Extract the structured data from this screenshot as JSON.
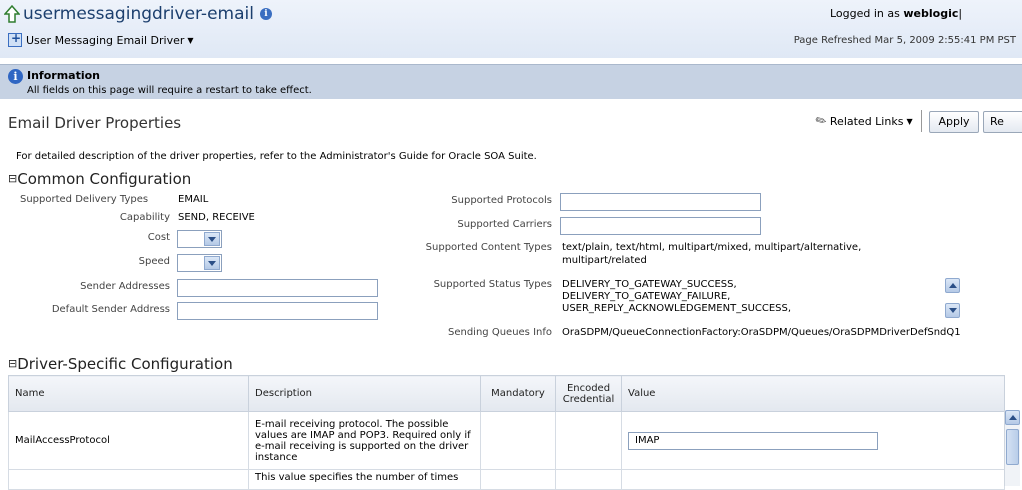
{
  "header": {
    "app_title": "usermessagingdriver-email",
    "target_menu": "User Messaging Email Driver",
    "logged_in_prefix": "Logged in as",
    "user": "weblogic",
    "refreshed": "Page Refreshed Mar 5, 2009 2:55:41 PM PST"
  },
  "info": {
    "title": "Information",
    "text": "All fields on this page will require a restart to take effect."
  },
  "page": {
    "title": "Email Driver Properties",
    "related_links": "Related Links",
    "apply": "Apply",
    "revert": "Re",
    "description": "For detailed description of the driver properties, refer to the Administrator's Guide for Oracle SOA Suite."
  },
  "common": {
    "section_title": "Common Configuration",
    "toggle": "⊟",
    "delivery_types_label": "Supported Delivery Types",
    "delivery_types_value": "EMAIL",
    "capability_label": "Capability",
    "capability_value": "SEND, RECEIVE",
    "cost_label": "Cost",
    "speed_label": "Speed",
    "sender_addresses_label": "Sender Addresses",
    "default_sender_label": "Default Sender Address",
    "protocols_label": "Supported Protocols",
    "carriers_label": "Supported Carriers",
    "content_types_label": "Supported Content Types",
    "content_types_value_1": "text/plain, text/html, multipart/mixed, multipart/alternative,",
    "content_types_value_2": "multipart/related",
    "status_types_label": "Supported Status Types",
    "status_types": [
      "DELIVERY_TO_GATEWAY_SUCCESS,",
      "DELIVERY_TO_GATEWAY_FAILURE,",
      "USER_REPLY_ACKNOWLEDGEMENT_SUCCESS,"
    ],
    "queues_label": "Sending Queues Info",
    "queues_value": "OraSDPM/QueueConnectionFactory:OraSDPM/Queues/OraSDPMDriverDefSndQ1"
  },
  "driver": {
    "section_title": "Driver-Specific Configuration",
    "toggle": "⊟",
    "columns": [
      "Name",
      "Description",
      "Mandatory",
      "Encoded Credential",
      "Value"
    ],
    "rows": [
      {
        "name": "MailAccessProtocol",
        "description": "E-mail receiving protocol. The possible values are IMAP and POP3. Required only if e-mail receiving is supported on the driver instance",
        "value": "IMAP"
      },
      {
        "name": "",
        "description": "This value specifies the number of times",
        "value": ""
      }
    ]
  }
}
